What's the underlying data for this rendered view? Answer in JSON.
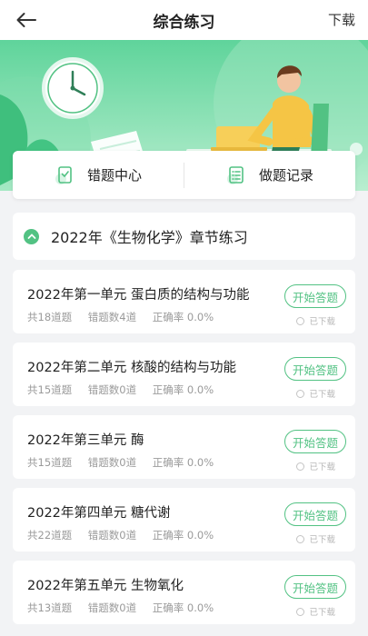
{
  "header": {
    "title": "综合练习",
    "download": "下载"
  },
  "quick": {
    "wrong_center": "错题中心",
    "history": "做题记录"
  },
  "chapter": {
    "title": "2022年《生物化学》章节练习"
  },
  "units": [
    {
      "title": "2022年第一单元 蛋白质的结构与功能",
      "total": "共18道题",
      "wrong": "错题数4道",
      "rate": "正确率 0.0%",
      "action": "开始答题",
      "status": "已下载"
    },
    {
      "title": "2022年第二单元 核酸的结构与功能",
      "total": "共15道题",
      "wrong": "错题数0道",
      "rate": "正确率 0.0%",
      "action": "开始答题",
      "status": "已下载"
    },
    {
      "title": "2022年第三单元 酶",
      "total": "共15道题",
      "wrong": "错题数0道",
      "rate": "正确率 0.0%",
      "action": "开始答题",
      "status": "已下载"
    },
    {
      "title": "2022年第四单元 糖代谢",
      "total": "共22道题",
      "wrong": "错题数0道",
      "rate": "正确率 0.0%",
      "action": "开始答题",
      "status": "已下载"
    },
    {
      "title": "2022年第五单元 生物氧化",
      "total": "共13道题",
      "wrong": "错题数0道",
      "rate": "正确率 0.0%",
      "action": "开始答题",
      "status": "已下载"
    }
  ],
  "colors": {
    "accent": "#52c283",
    "hero_top": "#5fd49b",
    "hero_bottom": "#b9eed0"
  }
}
